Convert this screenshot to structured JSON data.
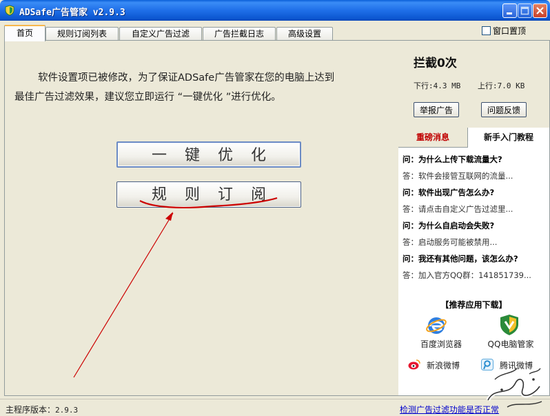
{
  "window": {
    "title": "ADSafe广告管家 v2.9.3"
  },
  "tabs": [
    "首页",
    "规则订阅列表",
    "自定义广告过滤",
    "广告拦截日志",
    "高级设置"
  ],
  "window_on_top": {
    "label": "窗口置顶",
    "checked": false
  },
  "main": {
    "notice_line1": "软件设置项已被修改，为了保证ADSafe广告管家在您的电脑上达到",
    "notice_line2": "最佳广告过滤效果，建议您立即运行 “一键优化 ”进行优化。",
    "optimize_button": "一键优化",
    "subscribe_button": "规则订阅"
  },
  "side": {
    "block_count": "拦截0次",
    "download": "下行:4.3 MB",
    "upload": "上行:7.0 KB",
    "report_button": "举报广告",
    "feedback_button": "问题反馈",
    "tab_news": "重磅消息",
    "tab_guide": "新手入门教程",
    "faq": [
      {
        "q": "问：为什么上传下载流量大?",
        "a": "答：软件会接管互联网的流量..."
      },
      {
        "q": "问：软件出现广告怎么办?",
        "a": "答：请点击自定义广告过滤里..."
      },
      {
        "q": "问：为什么自启动会失败?",
        "a": "答：启动服务可能被禁用..."
      },
      {
        "q": "问：我还有其他问题，该怎么办?",
        "a": "答：加入官方QQ群：141851739..."
      }
    ],
    "recommend_title": "【推荐应用下载】",
    "apps": [
      {
        "name": "百度浏览器",
        "icon": "baidu-browser-icon"
      },
      {
        "name": "QQ电脑管家",
        "icon": "qq-pc-manager-icon"
      },
      {
        "name": "新浪微博",
        "icon": "sina-weibo-icon"
      },
      {
        "name": "腾讯微博",
        "icon": "tencent-weibo-icon"
      }
    ]
  },
  "status": {
    "version_label": "主程序版本：",
    "version": "2.9.3",
    "check_link": "检测广告过滤功能是否正常"
  },
  "colors": {
    "titlebar": "#1f6fe8",
    "news_tab": "#c00000",
    "annotation": "#cc0000",
    "link": "#0000cc"
  }
}
